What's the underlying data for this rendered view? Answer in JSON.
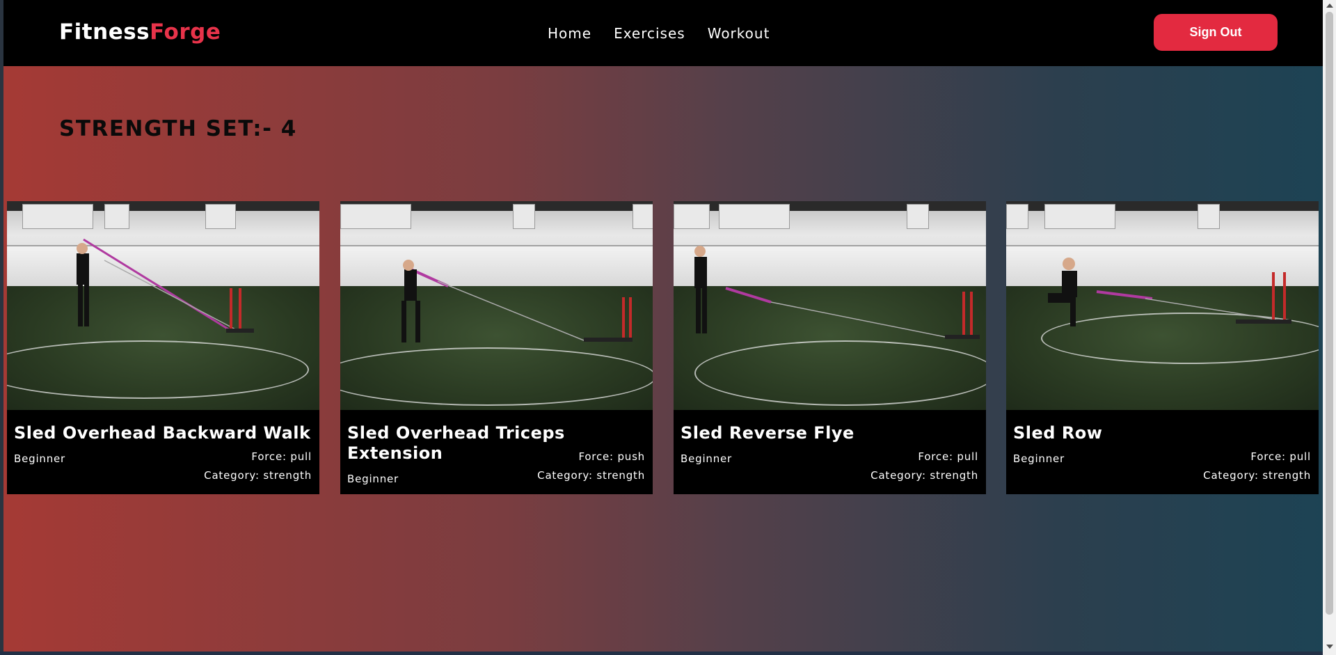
{
  "brand": {
    "part1": "Fitness",
    "part2": "Forge"
  },
  "nav": {
    "home": "Home",
    "exercises": "Exercises",
    "workout": "Workout"
  },
  "auth": {
    "signout_label": "Sign Out"
  },
  "page": {
    "title": "STRENGTH SET:- 4"
  },
  "exercises": [
    {
      "name": "Sled Overhead Backward Walk",
      "level": "Beginner",
      "force": "Force: pull",
      "category": "Category: strength"
    },
    {
      "name": "Sled Overhead Triceps Extension",
      "level": "Beginner",
      "force": "Force: push",
      "category": "Category: strength"
    },
    {
      "name": "Sled Reverse Flye",
      "level": "Beginner",
      "force": "Force: pull",
      "category": "Category: strength"
    },
    {
      "name": "Sled Row",
      "level": "Beginner",
      "force": "Force: pull",
      "category": "Category: strength"
    }
  ],
  "colors": {
    "accent": "#e8334a",
    "button": "#e32a40",
    "navbar": "#000000",
    "gradient_start": "#a53a35",
    "gradient_end": "#1d4354"
  }
}
